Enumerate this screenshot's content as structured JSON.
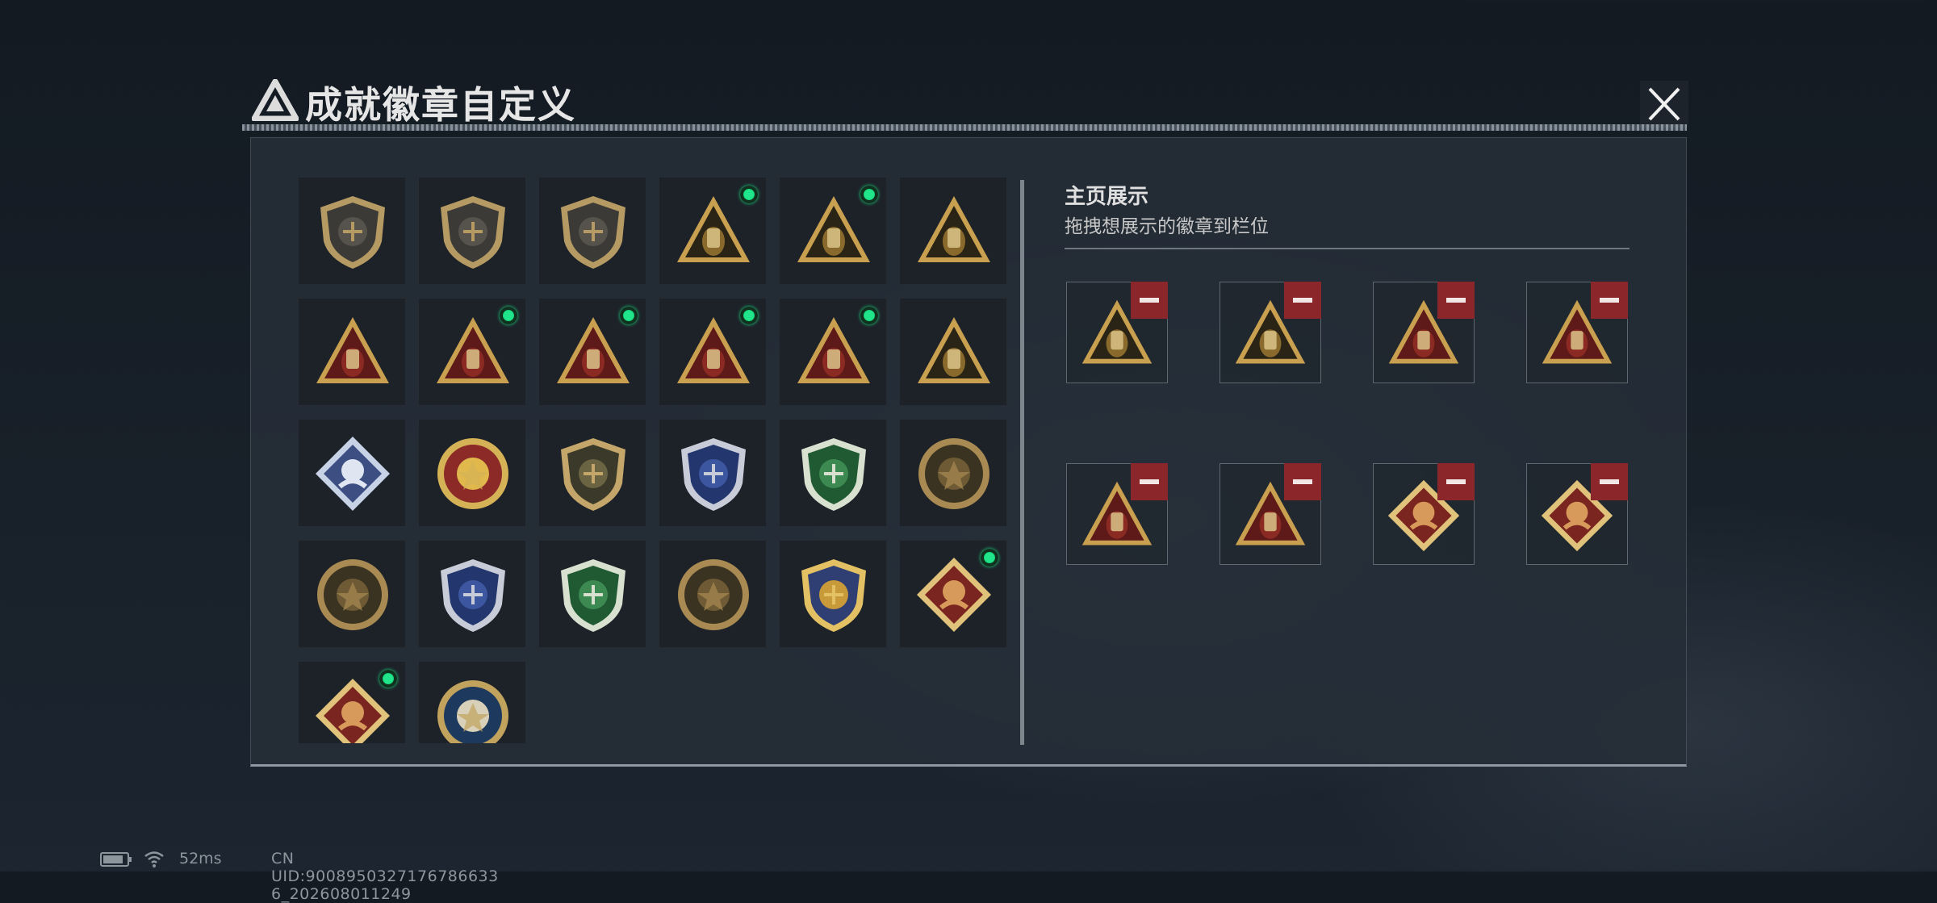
{
  "window": {
    "title": "成就徽章自定义",
    "title_icon": "triangle-emblem-icon",
    "close_icon": "close-x-icon"
  },
  "badge_grid": {
    "badges": [
      {
        "name": "shield-triangle-emblem-badge",
        "style": "shield-gray",
        "new": false
      },
      {
        "name": "helicopter-shield-badge",
        "style": "shield-gray",
        "new": false
      },
      {
        "name": "dagger-shield-badge",
        "style": "shield-gray",
        "new": false
      },
      {
        "name": "canister-57-badge",
        "style": "triangle-gold",
        "new": true
      },
      {
        "name": "satellite-59-badge",
        "style": "triangle-gold",
        "new": true
      },
      {
        "name": "egg-nest-badge",
        "style": "triangle-gold",
        "new": false
      },
      {
        "name": "number-one-badge",
        "style": "triangle-red",
        "new": false
      },
      {
        "name": "usb-drive-badge",
        "style": "triangle-red",
        "new": true
      },
      {
        "name": "mask-helmet-badge",
        "style": "triangle-red",
        "new": true
      },
      {
        "name": "kneeling-figure-badge",
        "style": "triangle-red",
        "new": true
      },
      {
        "name": "hands-dice-badge",
        "style": "triangle-red",
        "new": true
      },
      {
        "name": "soldiers-flag-badge",
        "style": "triangle-gold",
        "new": false
      },
      {
        "name": "blue-diamond-rose-badge",
        "style": "diamond-blue",
        "new": false
      },
      {
        "name": "red-star-medal-badge",
        "style": "round-red",
        "new": false
      },
      {
        "name": "olive-shield-badge",
        "style": "shield-olive",
        "new": false
      },
      {
        "name": "blue-laurel-shield-badge",
        "style": "shield-blue",
        "new": false
      },
      {
        "name": "green-laurel-shield-badge",
        "style": "shield-green",
        "new": false
      },
      {
        "name": "skull-crosshair-medal-badge",
        "style": "round-bronze",
        "new": false
      },
      {
        "name": "tank-sunburst-badge",
        "style": "round-bronze",
        "new": false
      },
      {
        "name": "blue-crosshair-rifle-badge",
        "style": "shield-blue",
        "new": false
      },
      {
        "name": "green-crosshair-rifle-badge",
        "style": "shield-green",
        "new": false
      },
      {
        "name": "rifle-round-badge",
        "style": "round-bronze",
        "new": false
      },
      {
        "name": "gold-crosshair-rifle-badge",
        "style": "shield-gold",
        "new": false
      },
      {
        "name": "red-dragon-diamond-badge",
        "style": "diamond-red",
        "new": true
      },
      {
        "name": "running-figure-diamond-badge",
        "style": "diamond-red",
        "new": true
      },
      {
        "name": "wolf-round-badge",
        "style": "round-blue",
        "new": false
      }
    ]
  },
  "showcase": {
    "title": "主页展示",
    "subtitle": "拖拽想展示的徽章到栏位",
    "slots": [
      {
        "name": "canister-57-badge",
        "style": "triangle-gold"
      },
      {
        "name": "satellite-59-badge",
        "style": "triangle-gold"
      },
      {
        "name": "kneeling-figure-badge",
        "style": "triangle-red"
      },
      {
        "name": "usb-drive-badge",
        "style": "triangle-red"
      },
      {
        "name": "mask-helmet-badge",
        "style": "triangle-red"
      },
      {
        "name": "hands-dice-badge",
        "style": "triangle-red"
      },
      {
        "name": "red-dragon-diamond-badge",
        "style": "diamond-red"
      },
      {
        "name": "running-figure-diamond-badge",
        "style": "diamond-red"
      }
    ]
  },
  "status_bar": {
    "ping": "52ms",
    "uid": "CN UID:9008950327176786633 6_202608011249",
    "battery_icon": "battery-icon",
    "wifi_icon": "wifi-icon"
  },
  "colors": {
    "new_indicator": "#21e58a",
    "remove_button": "#8b262b",
    "gold": "#c9a04f",
    "red": "#7a1f1f"
  }
}
